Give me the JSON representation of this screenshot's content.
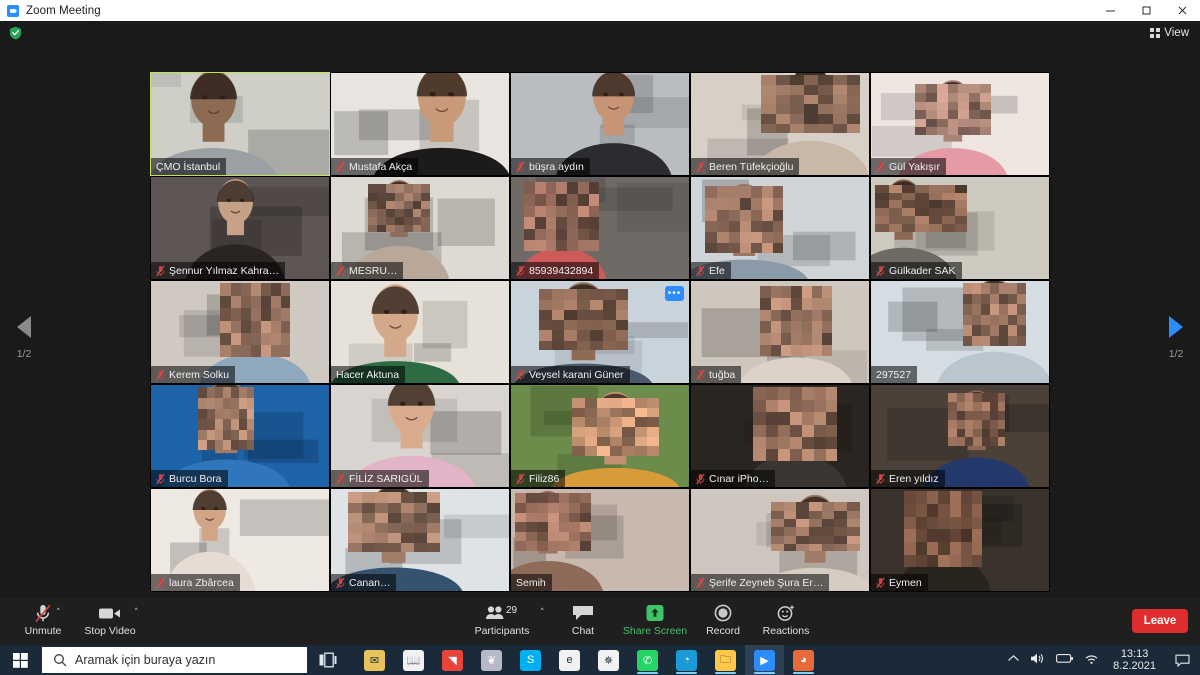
{
  "window": {
    "title": "Zoom Meeting",
    "app_icon": "zoom-icon",
    "minimize": "─",
    "maximize": "☐",
    "close": "✕"
  },
  "topbar": {
    "encryption_icon": "green-shield-icon",
    "view_label": "View",
    "view_icon": "grid-icon"
  },
  "pager": {
    "prev_icon": "chevron-left-icon",
    "next_icon": "chevron-right-icon",
    "left_page": "1/2",
    "right_page": "1/2"
  },
  "gallery": {
    "more_badge": "•••",
    "participants": [
      {
        "name": "ÇMO İstanbul",
        "muted": false,
        "active": true,
        "blurred": false,
        "bg": "#cfcfc8",
        "skin": "#8d6a52",
        "shirt": "#9aa0a4",
        "more": false
      },
      {
        "name": "Mustafa Akça",
        "muted": true,
        "active": false,
        "blurred": false,
        "bg": "#e8e5e0",
        "skin": "#c99a78",
        "shirt": "#1d1a1a",
        "more": false
      },
      {
        "name": "büşra aydın",
        "muted": true,
        "active": false,
        "blurred": false,
        "bg": "#b9bcc0",
        "skin": "#c79576",
        "shirt": "#2b2b30",
        "more": false
      },
      {
        "name": "Beren Tüfekçioğlu",
        "muted": true,
        "active": false,
        "blurred": true,
        "bg": "#d8cfc6",
        "skin": "#8a6a58",
        "shirt": "#c8b8a8",
        "more": false
      },
      {
        "name": "Gül Yakışır",
        "muted": true,
        "active": false,
        "blurred": true,
        "bg": "#efe6e2",
        "skin": "#a98375",
        "shirt": "#e59aa6",
        "more": false
      },
      {
        "name": "Şennur Yılmaz Kahra…",
        "muted": true,
        "active": false,
        "blurred": false,
        "bg": "#5e5654",
        "skin": "#c6a188",
        "shirt": "#2a2522",
        "more": false
      },
      {
        "name": "MESRU…",
        "muted": true,
        "active": false,
        "blurred": true,
        "bg": "#ded9d2",
        "skin": "#8e6d5c",
        "shirt": "#b9a89a",
        "more": false
      },
      {
        "name": "85939432894",
        "muted": true,
        "active": false,
        "blurred": true,
        "bg": "#6f6a66",
        "skin": "#9a6f5f",
        "shirt": "#cf5a5a",
        "more": false
      },
      {
        "name": "Efe",
        "muted": true,
        "active": false,
        "blurred": true,
        "bg": "#cfd4d8",
        "skin": "#9c7663",
        "shirt": "#8a9aa8",
        "more": false
      },
      {
        "name": "Gülkader SAK",
        "muted": true,
        "active": false,
        "blurred": true,
        "bg": "#cfcabf",
        "skin": "#8d6855",
        "shirt": "#6c6a62",
        "more": false
      },
      {
        "name": "Kerem Solku",
        "muted": true,
        "active": false,
        "blurred": true,
        "bg": "#cfc9c2",
        "skin": "#9a7562",
        "shirt": "#8fa8bd",
        "more": false
      },
      {
        "name": "Hacer Aktuna",
        "muted": false,
        "active": false,
        "blurred": false,
        "bg": "#e7e2d9",
        "skin": "#d3a98a",
        "shirt": "#2e6b43",
        "more": false
      },
      {
        "name": "Veysel karani Güner",
        "muted": true,
        "active": false,
        "blurred": true,
        "bg": "#c9d3dc",
        "skin": "#8e6a57",
        "shirt": "#4a5a6a",
        "more": true
      },
      {
        "name": "tuğba",
        "muted": true,
        "active": false,
        "blurred": true,
        "bg": "#cfc6bd",
        "skin": "#a07a66",
        "shirt": "#ddd2c8",
        "more": false
      },
      {
        "name": "297527",
        "muted": false,
        "active": false,
        "blurred": true,
        "bg": "#d5dde2",
        "skin": "#9c7662",
        "shirt": "#b9c6cf",
        "more": false
      },
      {
        "name": "Burcu Bora",
        "muted": true,
        "active": false,
        "blurred": true,
        "bg": "#1d63a8",
        "skin": "#a17b67",
        "shirt": "#2f76bb",
        "more": false
      },
      {
        "name": "FİLİZ SARIGÜL",
        "muted": true,
        "active": false,
        "blurred": false,
        "bg": "#d9d4cf",
        "skin": "#d8ac8d",
        "shirt": "#e3b3c8",
        "more": false
      },
      {
        "name": "Filiz86",
        "muted": true,
        "active": false,
        "blurred": true,
        "bg": "#6b8c4a",
        "skin": "#c09070",
        "shirt": "#d99a3a",
        "more": false
      },
      {
        "name": "Cınar iPho…",
        "muted": true,
        "active": false,
        "blurred": true,
        "bg": "#2a2520",
        "skin": "#9b7460",
        "shirt": "#3a3530",
        "more": false
      },
      {
        "name": "Eren yıldız",
        "muted": true,
        "active": false,
        "blurred": true,
        "bg": "#4b4138",
        "skin": "#8d6755",
        "shirt": "#23386b",
        "more": false
      },
      {
        "name": "laura Zbârcea",
        "muted": true,
        "active": false,
        "blurred": false,
        "bg": "#efe9e4",
        "skin": "#d2a586",
        "shirt": "#e6dcd4",
        "more": false
      },
      {
        "name": "Canan…",
        "muted": true,
        "active": false,
        "blurred": true,
        "bg": "#dfe3e6",
        "skin": "#a17c68",
        "shirt": "#35536f",
        "more": false
      },
      {
        "name": "Semih",
        "muted": false,
        "active": false,
        "blurred": true,
        "bg": "#c8b9ae",
        "skin": "#9d7260",
        "shirt": "#8e6a58",
        "more": false
      },
      {
        "name": "Şerife Zeyneb Şura Er…",
        "muted": true,
        "active": false,
        "blurred": true,
        "bg": "#cfc7bf",
        "skin": "#a07a66",
        "shirt": "#d6ccc2",
        "more": false
      },
      {
        "name": "Eymen",
        "muted": true,
        "active": false,
        "blurred": true,
        "bg": "#3a322c",
        "skin": "#7d5846",
        "shirt": "#2a241f",
        "more": false
      }
    ]
  },
  "toolbar": {
    "mute_label": "Unmute",
    "mute_icon": "mic-muted-icon",
    "video_label": "Stop Video",
    "video_icon": "camera-icon",
    "participants_label": "Participants",
    "participants_icon": "people-icon",
    "participants_count": "29",
    "chat_label": "Chat",
    "chat_icon": "chat-bubble-icon",
    "share_label": "Share Screen",
    "share_icon": "share-screen-icon",
    "record_label": "Record",
    "record_icon": "record-circle-icon",
    "reactions_label": "Reactions",
    "reactions_icon": "smiley-reactions-icon",
    "leave_label": "Leave",
    "caret": "˄",
    "share_color": "#41c36a",
    "leave_color": "#e02d2d"
  },
  "taskbar": {
    "start_icon": "windows-start-icon",
    "search_icon": "search-icon",
    "search_placeholder": "Aramak için buraya yazın",
    "search_value": "",
    "taskview_icon": "task-view-icon",
    "apps": [
      {
        "icon": "mail-app-icon",
        "glyph": "✉",
        "color": "#e8c25a",
        "running": false,
        "active": false
      },
      {
        "icon": "book-app-icon",
        "glyph": "📖",
        "color": "#f2f2f2",
        "running": false,
        "active": false
      },
      {
        "icon": "office-app-icon",
        "glyph": "◥",
        "color": "#e8443a",
        "running": false,
        "active": false
      },
      {
        "icon": "paint-3d-icon",
        "glyph": "❦",
        "color": "#b8b8c8",
        "running": false,
        "active": false
      },
      {
        "icon": "skype-icon",
        "glyph": "S",
        "color": "#00aff0",
        "running": false,
        "active": false
      },
      {
        "icon": "internet-explorer-icon",
        "glyph": "e",
        "color": "#f2f2f2",
        "running": false,
        "active": false
      },
      {
        "icon": "slack-icon",
        "glyph": "✵",
        "color": "#f2f2f2",
        "running": false,
        "active": false
      },
      {
        "icon": "whatsapp-icon",
        "glyph": "✆",
        "color": "#25d366",
        "running": true,
        "active": false
      },
      {
        "icon": "microsoft-edge-icon",
        "glyph": "◔",
        "color": "#1a9bd7",
        "running": true,
        "active": false
      },
      {
        "icon": "file-explorer-icon",
        "glyph": "🗀",
        "color": "#ffc848",
        "running": true,
        "active": false
      },
      {
        "icon": "zoom-app-icon",
        "glyph": "▶",
        "color": "#2d8cff",
        "running": true,
        "active": true
      },
      {
        "icon": "paint-app-icon",
        "glyph": "◕",
        "color": "#e86a3a",
        "running": true,
        "active": false
      }
    ],
    "tray": {
      "overflow_icon": "chevron-up-icon",
      "volume_icon": "speaker-icon",
      "battery_icon": "battery-icon",
      "network_icon": "wifi-icon",
      "time": "13:13",
      "date": "8.2.2021",
      "action_center_icon": "notification-icon"
    }
  }
}
